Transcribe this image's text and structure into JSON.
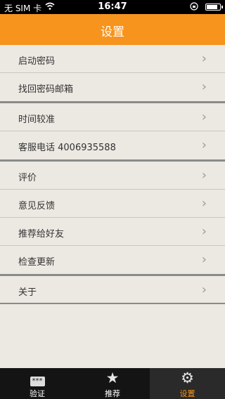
{
  "status_bar": {
    "carrier": "无 SIM 卡",
    "time": "16:47",
    "battery": 0.85
  },
  "nav": {
    "title": "设置"
  },
  "settings": [
    {
      "label": "启动密码"
    },
    {
      "label": "找回密码邮箱"
    },
    {
      "label": "时间较准"
    },
    {
      "label": "客服电话 4006935588"
    },
    {
      "label": "评价"
    },
    {
      "label": "意见反馈"
    },
    {
      "label": "推荐给好友"
    },
    {
      "label": "检查更新"
    },
    {
      "label": "关于"
    }
  ],
  "tabs": [
    {
      "label": "验证",
      "icon": "keypad-icon",
      "glyph": "***",
      "color": "#ffffff"
    },
    {
      "label": "推荐",
      "icon": "star-icon",
      "glyph": "★",
      "color": "#ffffff"
    },
    {
      "label": "设置",
      "icon": "gear-icon",
      "glyph": "⚙",
      "color": "#f7941e"
    }
  ]
}
